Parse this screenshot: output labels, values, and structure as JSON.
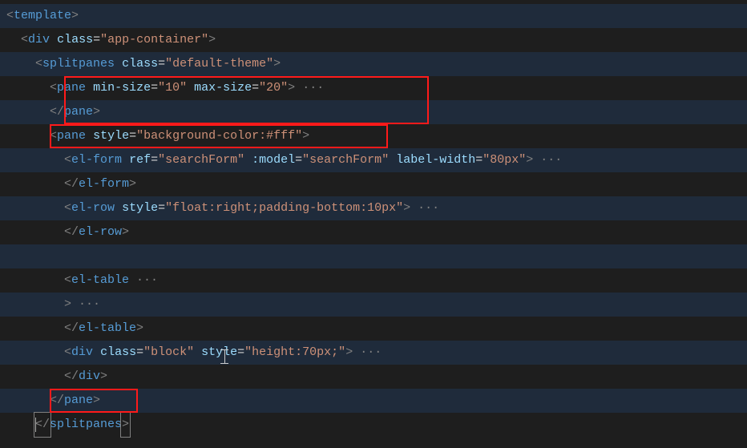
{
  "code": {
    "line1": {
      "ind": "",
      "open": "<",
      "tag": "template",
      "close": ">"
    },
    "line2": {
      "ind": "  ",
      "open": "<",
      "tag": "div",
      "attr1": "class",
      "eq": "=",
      "val1": "\"app-container\"",
      "close": ">"
    },
    "line3": {
      "ind": "    ",
      "open": "<",
      "tag": "splitpanes",
      "attr1": "class",
      "eq": "=",
      "val1": "\"default-theme\"",
      "close": ">"
    },
    "line4": {
      "ind": "      ",
      "open": "<",
      "tag": "pane",
      "attr1": "min-size",
      "eq": "=",
      "val1": "\"10\"",
      "attr2": "max-size",
      "val2": "\"20\"",
      "close": ">",
      "ell": " ···"
    },
    "line5": {
      "ind": "      ",
      "open": "</",
      "tag": "pane",
      "close": ">"
    },
    "line6": {
      "ind": "      ",
      "open": "<",
      "tag": "pane",
      "attr1": "style",
      "eq": "=",
      "val1": "\"background-color:#fff\"",
      "close": ">"
    },
    "line7": {
      "ind": "        ",
      "open": "<",
      "tag": "el-form",
      "attr1": "ref",
      "eq": "=",
      "val1": "\"searchForm\"",
      "attr2": ":model",
      "val2": "\"searchForm\"",
      "attr3": "label-width",
      "val3": "\"80px\"",
      "close": ">",
      "ell": " ···"
    },
    "line8": {
      "ind": "        ",
      "open": "</",
      "tag": "el-form",
      "close": ">"
    },
    "line9": {
      "ind": "        ",
      "open": "<",
      "tag": "el-row",
      "attr1": "style",
      "eq": "=",
      "val1": "\"float:right;padding-bottom:10px\"",
      "close": ">",
      "ell": " ···"
    },
    "line10": {
      "ind": "        ",
      "open": "</",
      "tag": "el-row",
      "close": ">"
    },
    "line11": {
      "ind": ""
    },
    "line12": {
      "ind": "        ",
      "open": "<",
      "tag": "el-table",
      "ell": " ···"
    },
    "line13": {
      "ind": "        ",
      "close": ">",
      "ell": " ···"
    },
    "line14": {
      "ind": "        ",
      "open": "</",
      "tag": "el-table",
      "close": ">"
    },
    "line15": {
      "ind": "        ",
      "open": "<",
      "tag": "div",
      "attr1": "class",
      "eq": "=",
      "val1": "\"block\"",
      "attr2": "style",
      "val2": "\"height:70px;\"",
      "close": ">",
      "ell": " ···"
    },
    "line16": {
      "ind": "        ",
      "open": "</",
      "tag": "div",
      "close": ">"
    },
    "line17": {
      "ind": "      ",
      "open": "</",
      "tag": "pane",
      "close": ">"
    },
    "line18": {
      "ind": "    ",
      "open": "</",
      "tag": "splitpanes",
      "close": ">"
    }
  }
}
